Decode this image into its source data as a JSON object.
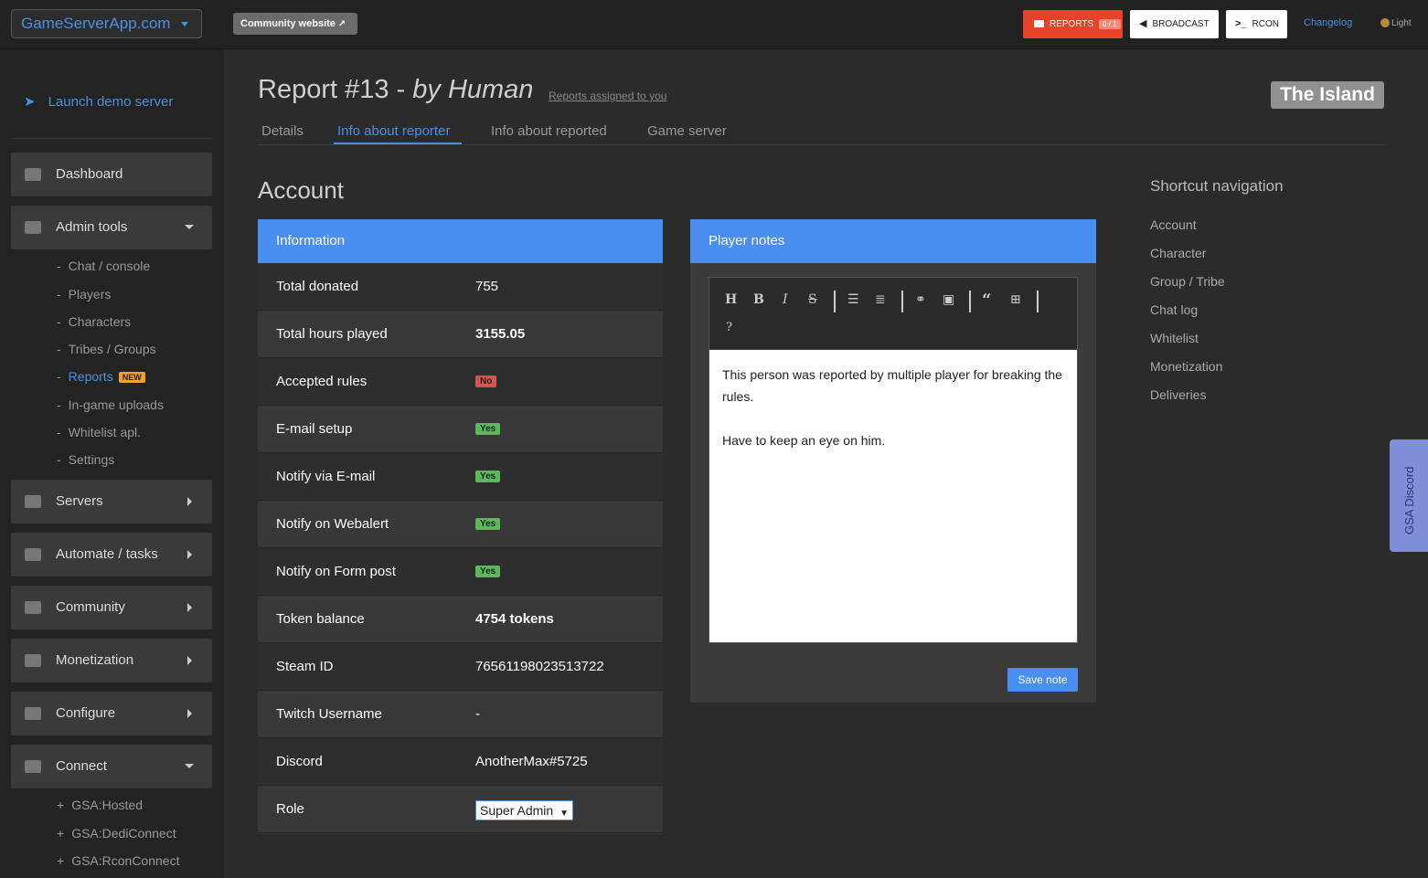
{
  "topbar": {
    "brand": "GameServerApp.com",
    "community_website": "Community website",
    "reports_label": "REPORTS",
    "reports_count": "0 / 1",
    "broadcast_label": "BROADCAST",
    "rcon_label": "RCON",
    "changelog": "Changelog",
    "theme_label": "Light"
  },
  "sidebar": {
    "launch_demo": "Launch demo server",
    "dashboard": "Dashboard",
    "admin_tools": "Admin tools",
    "admin_sub": [
      "Chat / console",
      "Players",
      "Characters",
      "Tribes / Groups",
      "Reports",
      "In-game uploads",
      "Whitelist apl.",
      "Settings"
    ],
    "new_badge": "NEW",
    "servers": "Servers",
    "automate": "Automate / tasks",
    "community": "Community",
    "monetization": "Monetization",
    "configure": "Configure",
    "connect": "Connect",
    "connect_sub": [
      "GSA:Hosted",
      "GSA:DediConnect",
      "GSA:RconConnect"
    ]
  },
  "header": {
    "report_title": "Report #13 - ",
    "by_human": "by Human",
    "assigned_link": "Reports assigned to you",
    "server_badge": "The Island"
  },
  "tabs": [
    "Details",
    "Info about reporter",
    "Info about reported",
    "Game server"
  ],
  "section_title": "Account",
  "information": {
    "heading": "Information",
    "rows": [
      {
        "label": "Total donated",
        "value": "755"
      },
      {
        "label": "Total hours played",
        "value": "3155.05"
      },
      {
        "label": "Accepted rules",
        "value": "No"
      },
      {
        "label": "E-mail setup",
        "value": "Yes"
      },
      {
        "label": "Notify via E-mail",
        "value": "Yes"
      },
      {
        "label": "Notify on Webalert",
        "value": "Yes"
      },
      {
        "label": "Notify on Form post",
        "value": "Yes"
      },
      {
        "label": "Token balance",
        "value": "4754 tokens"
      },
      {
        "label": "Steam ID",
        "value": "76561198023513722"
      },
      {
        "label": "Twitch Username",
        "value": "-"
      },
      {
        "label": "Discord",
        "value": "AnotherMax#5725"
      },
      {
        "label": "Role",
        "value": "Super Admin"
      }
    ]
  },
  "notes": {
    "heading": "Player notes",
    "line1": "This person was reported by multiple player for breaking the rules.",
    "line2": "Have to keep an eye on him.",
    "save_label": "Save note"
  },
  "shortcuts": {
    "title": "Shortcut navigation",
    "items": [
      "Account",
      "Character",
      "Group / Tribe",
      "Chat log",
      "Whitelist",
      "Monetization",
      "Deliveries"
    ]
  },
  "discord_tab": "GSA Discord",
  "colors": {
    "accent": "#4a8ff0",
    "reports_red": "#e8432a",
    "yes_green": "#5cb85c",
    "no_red": "#d9534f"
  }
}
